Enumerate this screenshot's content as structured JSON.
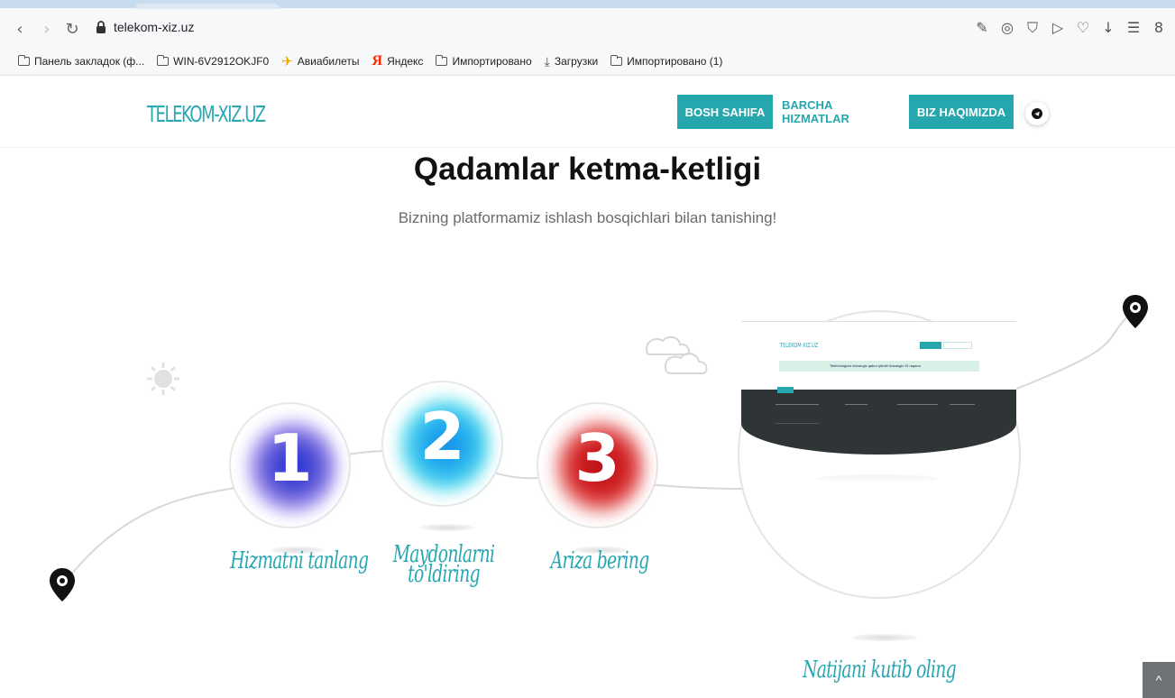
{
  "browser": {
    "url": "telekom-xiz.uz",
    "bookmarks": [
      {
        "label": "Панель закладок (ф...",
        "icon": "folder-icon"
      },
      {
        "label": "WIN-6V2912OKJF0",
        "icon": "folder-icon"
      },
      {
        "label": "Авиабилеты",
        "icon": "plane-icon"
      },
      {
        "label": "Яндекс",
        "icon": "yandex-icon"
      },
      {
        "label": "Импортировано",
        "icon": "folder-icon"
      },
      {
        "label": "Загрузки",
        "icon": "download-icon"
      },
      {
        "label": "Импортировано (1)",
        "icon": "folder-icon"
      }
    ],
    "toolbar_icons": [
      "edit-icon",
      "camera-icon",
      "shield-icon",
      "send-icon",
      "heart-icon",
      "download-icon",
      "menu-icon",
      "profile-icon"
    ]
  },
  "site": {
    "logo": "TELEKOM-XIZ.UZ",
    "nav": [
      {
        "label": "BOSH SAHIFA",
        "active": true
      },
      {
        "label": "BARCHA HIZMATLAR",
        "active": false
      },
      {
        "label": "BIZ HAQIMIZDA",
        "active": true
      }
    ],
    "title": "Qadamlar ketma-ketligi",
    "subtitle": "Bizning platformamiz ishlash bosqichlari bilan tanishing!",
    "steps": [
      {
        "number": "1",
        "label": "Hizmatni tanlang",
        "color": "#2a35c9"
      },
      {
        "number": "2",
        "label": "Maydonlarni to'ldiring",
        "color": "#18a9e6"
      },
      {
        "number": "3",
        "label": "Ariza bering",
        "color": "#d92424"
      }
    ],
    "final_step": "Natijani kutib oling",
    "preview": {
      "logo": "TELEKOM-XIZ.UZ",
      "notice": "Telefoningizni Arizangiz qabul qilindi! Arizangiz ID raqami"
    },
    "scroll_top_label": "^"
  }
}
